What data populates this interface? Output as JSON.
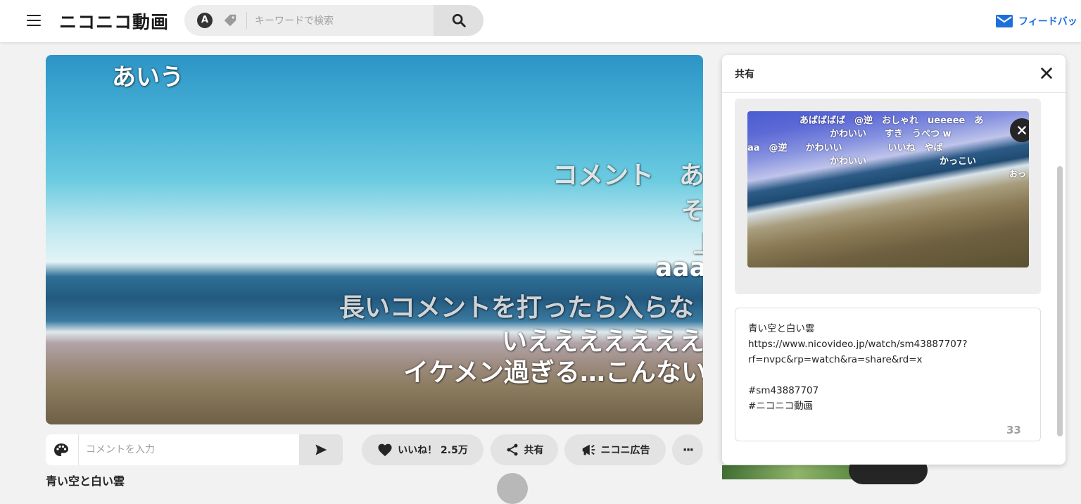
{
  "header": {
    "logo": "ニコニコ動画",
    "search_placeholder": "キーワードで検索",
    "search_mode_letter": "A",
    "feedback_label": "フィードバッ"
  },
  "player": {
    "comments": [
      {
        "text": "あいう"
      },
      {
        "text": "コメント　あ"
      },
      {
        "text": "そ"
      },
      {
        "text": "上"
      },
      {
        "text": "aaa"
      },
      {
        "text": "長いコメントを打ったら入らな"
      },
      {
        "text": "いえええええええ"
      },
      {
        "text": "イケメン過ぎる…こんない"
      }
    ]
  },
  "comment_bar": {
    "placeholder": "コメントを入力"
  },
  "actions": {
    "like_label": "いいね！ 2.5万",
    "share_label": "共有",
    "ad_label": "ニコニ広告",
    "more_label": "···"
  },
  "share_modal": {
    "title": "共有",
    "preview_comments": [
      {
        "text": "あばばばば　@逆　おしゃれ　ueeeee　あ"
      },
      {
        "text": "かわいい　　すき　うぺつ w"
      },
      {
        "text": "aa　@逆　　かわいい　　　　　いいね　やば"
      },
      {
        "text": "かわいい　　　　　　　　かっこい"
      },
      {
        "text": "おっ"
      }
    ],
    "share_text": "青い空と白い雲\nhttps://www.nicovideo.jp/watch/sm43887707?\nrf=nvpc&rp=watch&ra=share&rd=x\n\n#sm43887707\n#ニコニコ動画",
    "char_count": "33"
  },
  "below": {
    "title": "青い空と白い雲"
  }
}
